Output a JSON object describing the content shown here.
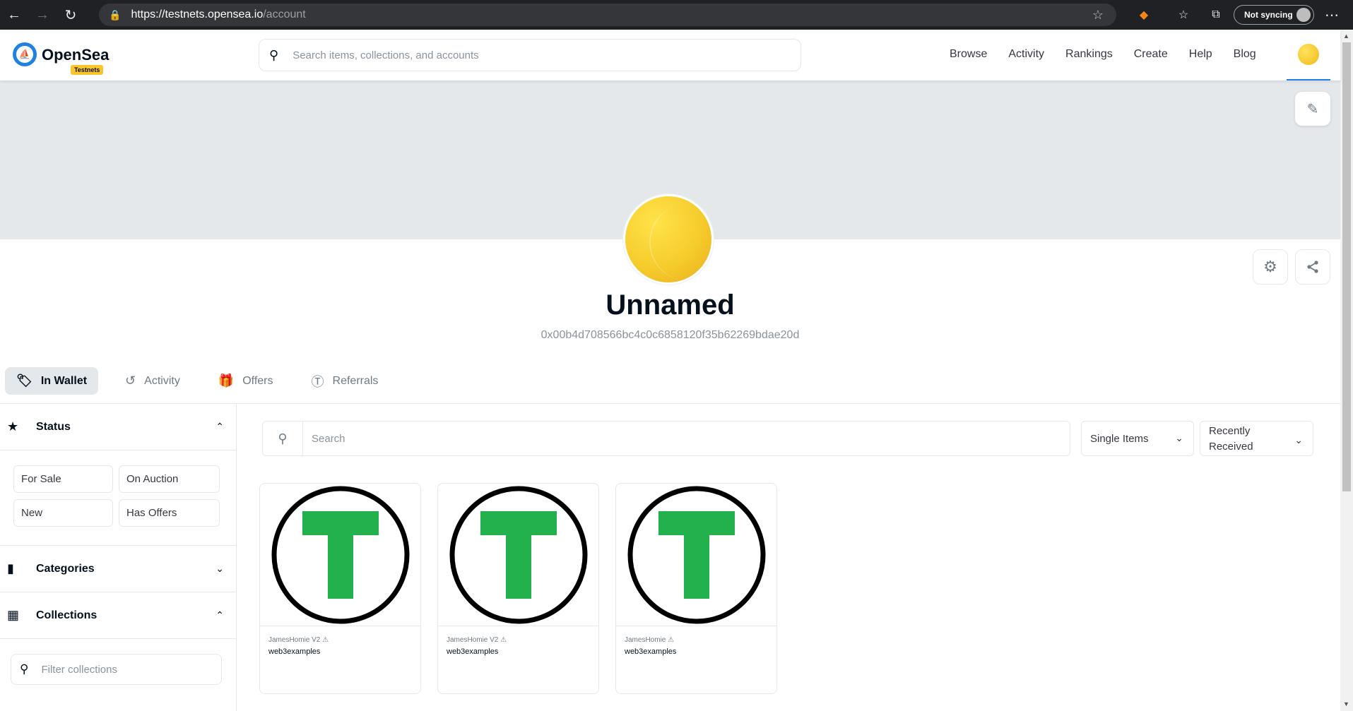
{
  "browser": {
    "url_host": "https://testnets.opensea.io",
    "url_path": "/account",
    "sync_label": "Not syncing"
  },
  "header": {
    "logo_text": "OpenSea",
    "badge": "Testnets",
    "search_placeholder": "Search items, collections, and accounts",
    "nav": [
      "Browse",
      "Activity",
      "Rankings",
      "Create",
      "Help",
      "Blog"
    ]
  },
  "profile": {
    "name": "Unnamed",
    "address": "0x00b4d708566bc4c0c6858120f35b62269bdae20d"
  },
  "tabs": [
    {
      "label": "In Wallet",
      "icon": "tag-icon",
      "active": true
    },
    {
      "label": "Activity",
      "icon": "history-icon",
      "active": false
    },
    {
      "label": "Offers",
      "icon": "gift-icon",
      "active": false
    },
    {
      "label": "Referrals",
      "icon": "dollar-icon",
      "active": false
    }
  ],
  "sidebar": {
    "status_label": "Status",
    "status_filters": [
      "For Sale",
      "On Auction",
      "New",
      "Has Offers"
    ],
    "categories_label": "Categories",
    "collections_label": "Collections",
    "collections_placeholder": "Filter collections"
  },
  "toolbar": {
    "search_placeholder": "Search",
    "items_select": "Single Items",
    "sort_select_line1": "Recently",
    "sort_select_line2": "Received"
  },
  "cards": [
    {
      "collection": "JamesHomie V2",
      "name": "web3examples",
      "icon": "token-t-icon"
    },
    {
      "collection": "JamesHomie V2",
      "name": "web3examples",
      "icon": "token-t-icon"
    },
    {
      "collection": "JamesHomie",
      "name": "web3examples",
      "icon": "token-t-icon"
    }
  ],
  "colors": {
    "accent": "#2081e2",
    "token_green": "#22b14c",
    "avatar_yellow": "#f6cc2c",
    "banner": "#e5e8eb"
  }
}
